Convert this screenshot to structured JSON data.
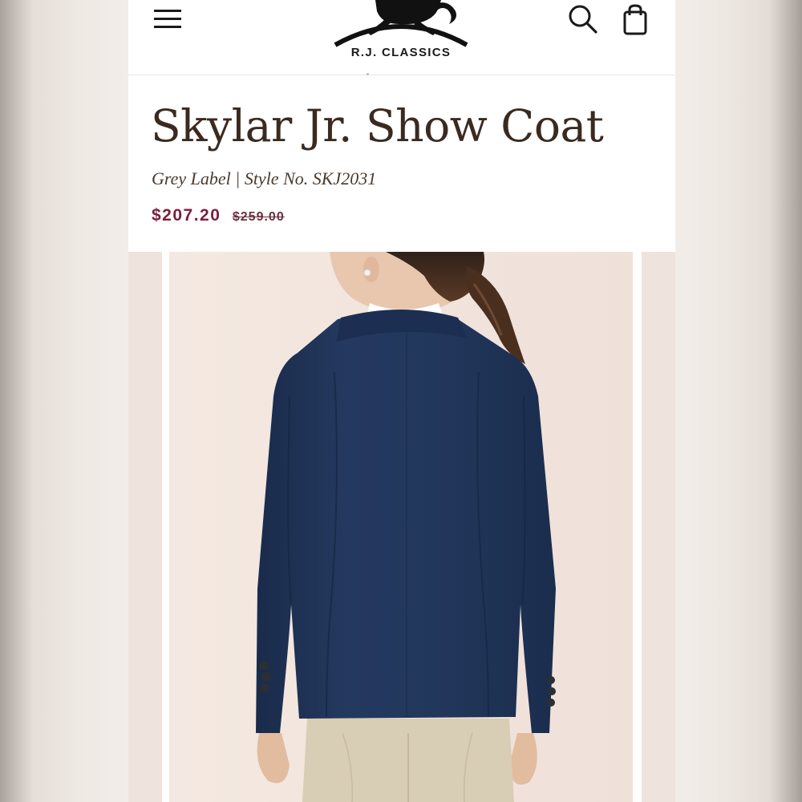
{
  "header": {
    "brand_name": "R.J. CLASSICS",
    "icons": [
      "hamburger-menu-icon",
      "search-icon",
      "shopping-bag-icon"
    ]
  },
  "product": {
    "title": "Skylar Jr. Show Coat",
    "subtitle": "Grey Label | Style No. SKJ2031",
    "sale_price": "$207.20",
    "original_price": "$259.00"
  },
  "colors": {
    "title": "#3b2a20",
    "sale_price": "#7a1f3b",
    "coat": "#22385e",
    "image_background": "#f2e6df"
  }
}
